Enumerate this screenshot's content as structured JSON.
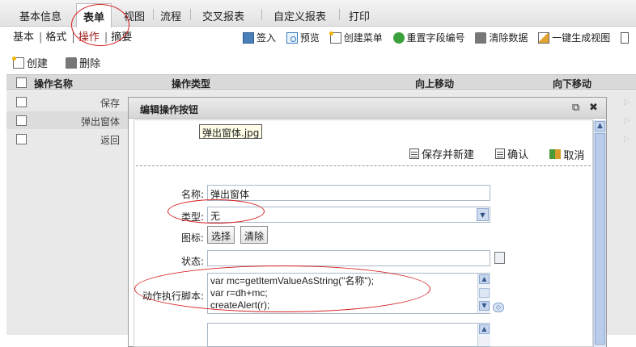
{
  "top_tabs": [
    {
      "label": "基本信息",
      "active": false
    },
    {
      "label": "表单",
      "active": true
    },
    {
      "label": "视图",
      "active": false
    },
    {
      "label": "流程",
      "active": false
    },
    {
      "label": "交叉报表",
      "active": false
    },
    {
      "label": "自定义报表",
      "active": false
    },
    {
      "label": "打印",
      "active": false
    }
  ],
  "sub_nav": [
    "基本",
    "格式",
    "操作",
    "摘要"
  ],
  "toolbar": {
    "sign": "签入",
    "preview": "预览",
    "create_menu": "创建菜单",
    "reset_field_no": "重置字段编号",
    "clear_data": "清除数据",
    "one_click_view": "一键生成视图"
  },
  "actions": {
    "create": "创建",
    "delete": "删除"
  },
  "grid": {
    "columns": [
      "操作名称",
      "操作类型",
      "向上移动",
      "向下移动"
    ],
    "rows": [
      "保存",
      "弹出窗体",
      "返回"
    ]
  },
  "dialog": {
    "title": "编辑操作按钮",
    "tooltip": "弹出窗体.jpg",
    "save_new": "保存并新建",
    "confirm": "确认",
    "cancel": "取消",
    "labels": {
      "name": "名称:",
      "type": "类型:",
      "icon": "图标:",
      "state": "状态:",
      "script": "动作执行脚本:"
    },
    "name_value": "弹出窗体",
    "type_value": "无",
    "select_btn": "选择",
    "clear_btn": "清除",
    "state_value": "",
    "script_value": "var mc=getItemValueAsString(\"名称\");\nvar r=dh+mc;\ncreateAlert(r);",
    "extra_value": ""
  },
  "accent_color": "#d62020"
}
